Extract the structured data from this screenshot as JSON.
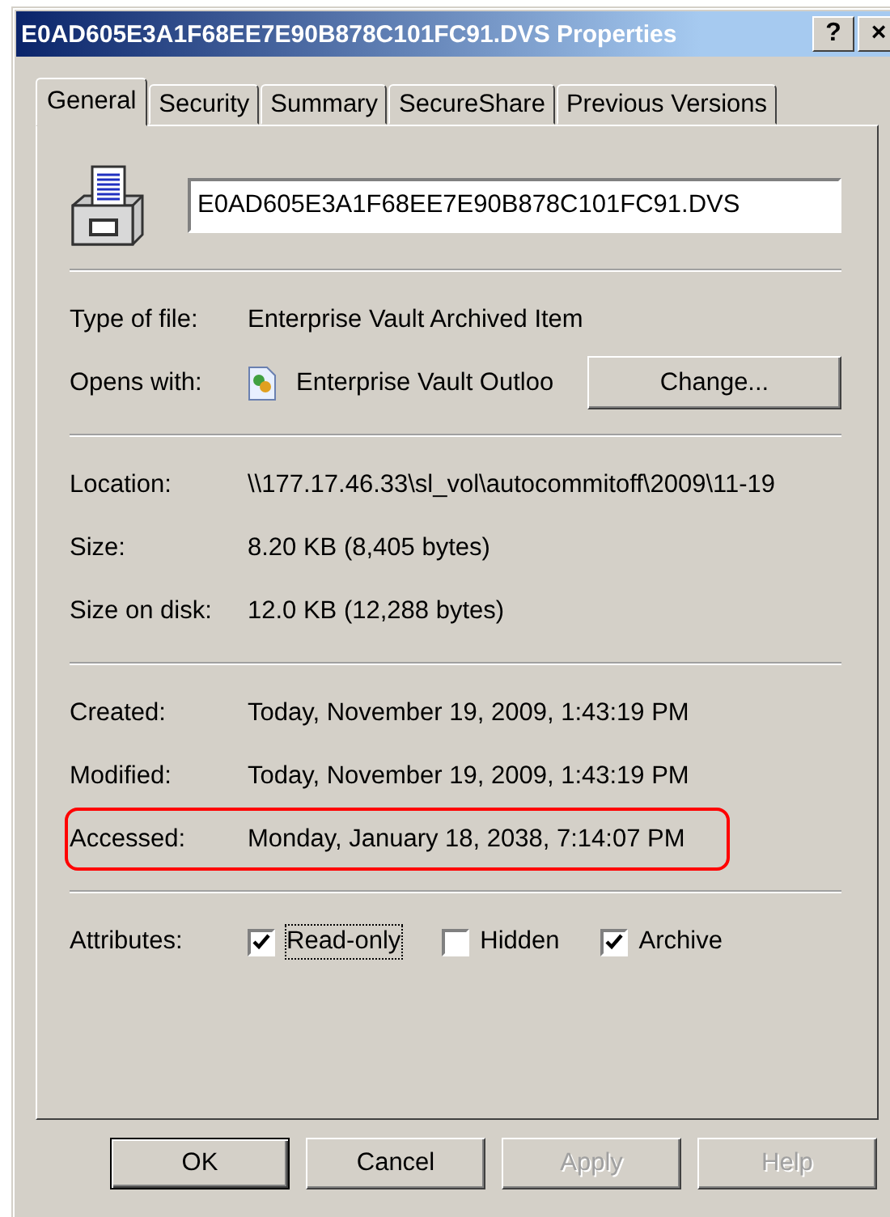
{
  "window": {
    "title": "E0AD605E3A1F68EE7E90B878C101FC91.DVS Properties",
    "buttons": [
      "?",
      "×"
    ]
  },
  "tabs": [
    {
      "label": "General",
      "selected": true
    },
    {
      "label": "Security",
      "selected": false
    },
    {
      "label": "Summary",
      "selected": false
    },
    {
      "label": "SecureShare",
      "selected": false
    },
    {
      "label": "Previous Versions",
      "selected": false
    }
  ],
  "file_name": {
    "value": "E0AD605E3A1F68EE7E90B878C101FC91.DVS"
  },
  "sections": [
    {
      "rows": [
        {
          "kind": "text",
          "label": "Type of file:",
          "value": "Enterprise Vault Archived Item",
          "highlighted": false
        },
        {
          "kind": "opens_with",
          "label": "Opens with:",
          "value": "Enterprise Vault Outloo",
          "button": "Change...",
          "highlighted": false
        }
      ]
    },
    {
      "rows": [
        {
          "kind": "text",
          "label": "Location:",
          "value": "\\\\177.17.46.33\\sl_vol\\autocommitoff\\2009\\11-19",
          "highlighted": false
        },
        {
          "kind": "text",
          "label": "Size:",
          "value": "8.20 KB (8,405 bytes)",
          "highlighted": false
        },
        {
          "kind": "text",
          "label": "Size on disk:",
          "value": "12.0 KB (12,288 bytes)",
          "highlighted": false
        }
      ]
    },
    {
      "rows": [
        {
          "kind": "text",
          "label": "Created:",
          "value": "Today, November 19, 2009, 1:43:19 PM",
          "highlighted": false
        },
        {
          "kind": "text",
          "label": "Modified:",
          "value": "Today, November 19, 2009, 1:43:19 PM",
          "highlighted": false
        },
        {
          "kind": "text",
          "label": "Accessed:",
          "value": "Monday, January 18, 2038, 7:14:07 PM",
          "highlighted": true
        }
      ]
    }
  ],
  "attributes": {
    "label": "Attributes:",
    "options": [
      {
        "label": "Read-only",
        "checked": true,
        "focused": true
      },
      {
        "label": "Hidden",
        "checked": false,
        "focused": false
      },
      {
        "label": "Archive",
        "checked": true,
        "focused": false
      }
    ]
  },
  "buttons": [
    {
      "label": "OK",
      "default": true,
      "disabled": false
    },
    {
      "label": "Cancel",
      "default": false,
      "disabled": false
    },
    {
      "label": "Apply",
      "default": false,
      "disabled": true
    },
    {
      "label": "Help",
      "default": false,
      "disabled": true
    }
  ]
}
